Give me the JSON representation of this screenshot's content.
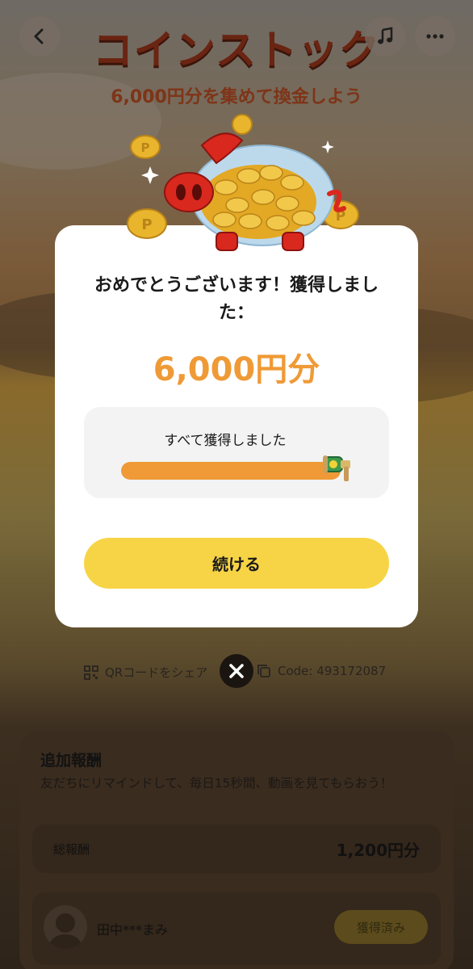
{
  "header": {
    "title": "コインストック",
    "subtitle": "6,000円分を集めて換金しよう",
    "back_icon": "chevron-left-icon",
    "music_icon": "music-note-icon",
    "more_icon": "more-dots-icon"
  },
  "modal": {
    "headline": "おめでとうございます！獲得しました：",
    "amount": "6,000円分",
    "progress_label": "すべて獲得しました",
    "progress_fraction": 1.0,
    "continue_label": "続ける",
    "close_icon": "close-x-icon"
  },
  "share": {
    "qr_label": "QRコードをシェア",
    "code_label": "Code: 493172087"
  },
  "bonus": {
    "title": "追加報酬",
    "description": "友だちにリマインドして、毎日15秒間、動画を見てもらおう！",
    "total_label": "総報酬",
    "total_value": "1,200円分",
    "user_name": "田中***まみ",
    "user_status": "獲得済み"
  },
  "colors": {
    "accent_orange": "#ef9a36",
    "button_yellow": "#f7d445",
    "title_brown": "#6a2412"
  }
}
